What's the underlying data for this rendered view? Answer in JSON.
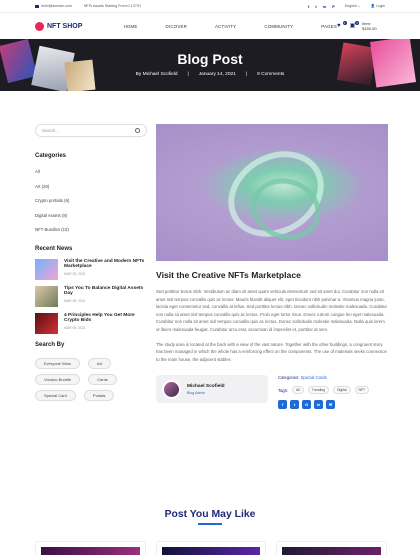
{
  "topbar": {
    "email": "hello@domain.com",
    "promo": "NFTs Assets Starting From 0.1 ETH",
    "social": [
      "f",
      "t",
      "in",
      "P"
    ],
    "language": "English",
    "login": "Login"
  },
  "nav": {
    "logo": "NFT SHOP",
    "menu": [
      "HOME",
      "DICOVER",
      "ACTIVITY",
      "COMMUNITY",
      "PAGES"
    ],
    "wishlist_count": "0",
    "cart_count": "0",
    "cart_total": "Item: $150.00"
  },
  "banner": {
    "title": "Blog Post",
    "author": "By Michael Scofield",
    "date": "January 14, 2021",
    "comments": "8 Comments"
  },
  "sidebar": {
    "search_placeholder": "Search...",
    "categories_title": "Categories",
    "categories": [
      "All",
      "Art (20)",
      "Crypto portaits (6)",
      "Digital Assets (8)",
      "NFT Bundles (10)"
    ],
    "recent_title": "Recent News",
    "recent": [
      {
        "title": "Visit the Creative and Modern NFTs Marketplace",
        "date": "MAR 05, 2021"
      },
      {
        "title": "Tips You To Balance Digital Assets Day",
        "date": "MAR 05, 2021"
      },
      {
        "title": "4 Principles Help You Get More Crypto Bids",
        "date": "MAR 05, 2021"
      }
    ],
    "searchby_title": "Search By",
    "tags": [
      "Everyone Wins",
      "Art",
      "Voodoo Bundle",
      "Cards",
      "Special Card",
      "Portals"
    ]
  },
  "post": {
    "title": "Visit the Creative NFTs Marketplace",
    "para1": "Sed porttitor lectus nibh. Vestibulum ac diam sit amet quam vehicula elementum sed sit amet dui. Curabitur non nulla sit amet nisl tempus convallis quis ac lectus. Mauris blandit aliquet elit, eget tincidunt nibh pulvinar a. Vivamus magna justo, lacinia eget consectetur sed, convallis at tellus. Sed porttitor lectus nibh. Donec sollicitudin molestie malesuada. Curabitur non nulla sit amet nisl tempus convallis quis ac lectus. Proin eget tortor risus. Donec rutrum congue leo eget malesuada. Curabitur non nulla sit amet nisl tempus convallis quis ac lectus. Donec sollicitudin molestie malesuada. Nulla quis lorem ut libero malesuada feugiat. Curabitur arcu erat, accumsan id imperdiet et, porttitor at sem.",
    "para2": "The study area is located at the back with a view of the vast nature. Together with the other buildings, a congruent story has been managed in which the whole has a reinforcing effect on the components. The use of materials seeks connection to the main house, the adjacent stables",
    "author_name": "Michael Scofield",
    "author_role": "Blog Admin",
    "categories_label": "Categories:",
    "categories_value": "Special Cards",
    "tags_label": "Tags:",
    "tags": [
      "All",
      "Trending",
      "Digital",
      "NFT"
    ],
    "share": [
      "f",
      "t",
      "G",
      "in",
      "✉"
    ]
  },
  "related": {
    "title": "Post You May Like"
  }
}
